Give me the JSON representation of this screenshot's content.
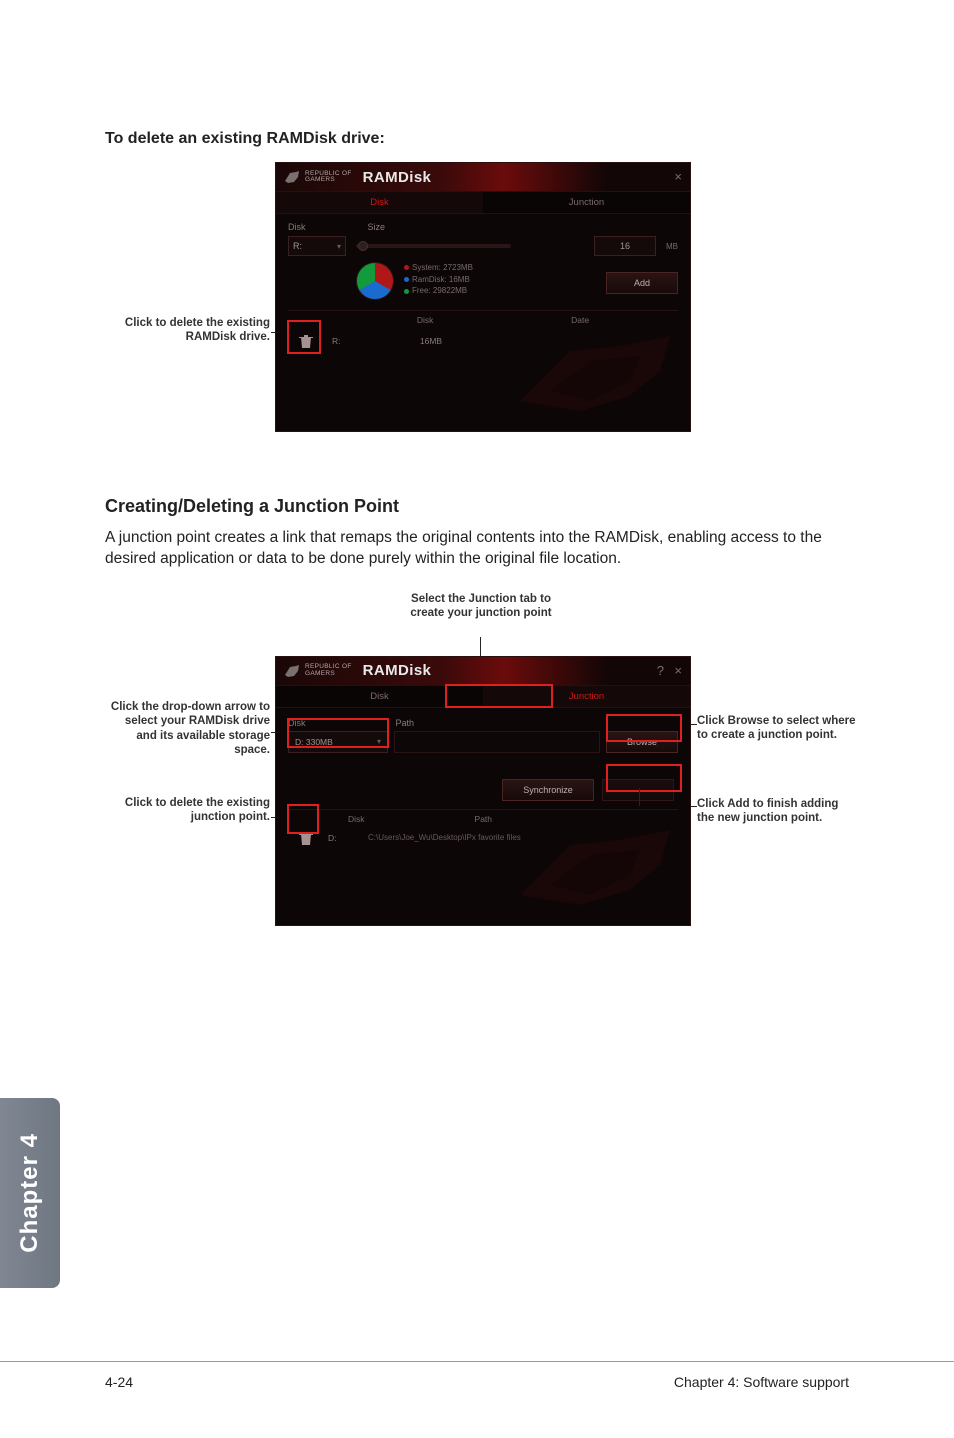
{
  "colors": {
    "accent_red": "#d01818",
    "callout_highlight": "#e02020"
  },
  "headings": {
    "delete_drive": "To delete an existing RAMDisk drive:",
    "junction": "Creating/Deleting a Junction Point"
  },
  "body": {
    "junction_text": "A junction point creates a link that remaps the original contents into the RAMDisk, enabling access to the desired application or data to be done purely within the original file location."
  },
  "brand": {
    "tag_line1": "REPUBLIC OF",
    "tag_line2": "GAMERS",
    "app_name": "RAMDisk"
  },
  "window1": {
    "tabs": {
      "disk": "Disk",
      "junction": "Junction"
    },
    "labels": {
      "disk": "Disk",
      "size": "Size",
      "date": "Date"
    },
    "disk_select_value": "R:",
    "size_value": "16",
    "size_unit": "MB",
    "stats": {
      "system": "System: 2723MB",
      "ramdisk": "RamDisk: 16MB",
      "free": "Free: 29822MB"
    },
    "add_btn": "Add",
    "list": {
      "disk": "R:",
      "size": "16MB",
      "date": ""
    }
  },
  "window2": {
    "tabs": {
      "disk": "Disk",
      "junction": "Junction"
    },
    "labels": {
      "disk": "Disk",
      "path": "Path"
    },
    "disk_select_value": "D: 330MB",
    "browse_btn": "Browse",
    "sync_btn": "Synchronize",
    "list_headers": {
      "disk": "Disk",
      "path": "Path"
    },
    "list": {
      "disk": "D:",
      "path": "C:\\Users\\Joe_Wu\\Desktop\\IPx favorite files"
    }
  },
  "callouts": {
    "fig1_delete": "Click to delete the existing RAMDisk drive.",
    "fig2_junction_tab": "Select the Junction tab to create your junction point",
    "fig2_disk_dropdown": "Click the drop-down arrow to select your RAMDisk drive and its available storage space.",
    "fig2_delete_junction": "Click to delete the existing junction point.",
    "fig2_browse": "Click Browse to select where to create a junction point.",
    "fig2_add": "Click Add to finish adding the new junction point."
  },
  "footer": {
    "page_number": "4-24",
    "chapter_title": "Chapter 4: Software support",
    "chapter_tab": "Chapter 4"
  }
}
